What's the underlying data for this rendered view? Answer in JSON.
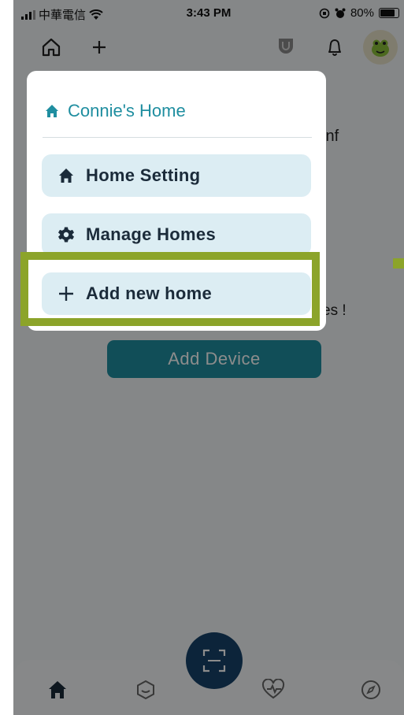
{
  "status_bar": {
    "carrier": "中華電信",
    "time": "3:43 PM",
    "battery": "80%",
    "battery_level": 0.8
  },
  "background": {
    "partial_text_1": "inf",
    "partial_text_2": "es !",
    "add_device_label": "Add Device"
  },
  "popup": {
    "home_name": "Connie's Home",
    "items": [
      {
        "label": "Home Setting",
        "icon": "home-icon"
      },
      {
        "label": "Manage Homes",
        "icon": "gear-icon"
      },
      {
        "label": "Add new home",
        "icon": "plus-icon"
      }
    ]
  },
  "colors": {
    "accent": "#1f8ea0",
    "menu_item_bg": "#dcedf3",
    "highlight": "#8ca42a",
    "scan_button": "#16436a"
  }
}
